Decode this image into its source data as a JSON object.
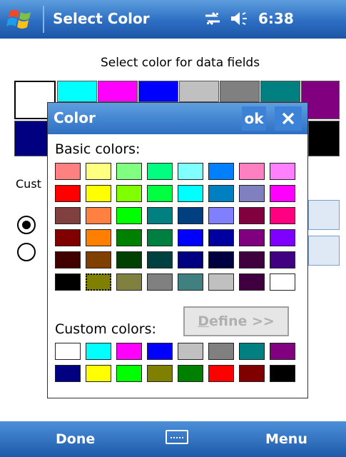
{
  "titlebar": {
    "title": "Select Color",
    "time": "6:38",
    "icons": [
      "windows-start-icon",
      "connectivity-icon",
      "volume-icon"
    ]
  },
  "page": {
    "prompt": "Select color for data fields",
    "background_swatches": [
      "#ffffff",
      "#00ffff",
      "#ff00ff",
      "#0000ff",
      "#c0c0c0",
      "#808080",
      "#008080",
      "#800080",
      "#000080",
      "#000000"
    ],
    "custom_label_partial": "Cust",
    "radio_checked": true
  },
  "dialog": {
    "title": "Color",
    "ok_label": "ok",
    "close_icon": "close-icon",
    "basic_colors_label": "Basic colors:",
    "custom_colors_label": "Custom colors:",
    "define_label": "Define >>",
    "basic_colors": [
      [
        "#ff8080",
        "#ffff80",
        "#80ff80",
        "#00ff80",
        "#80ffff",
        "#0080ff",
        "#ff80c0",
        "#ff80ff"
      ],
      [
        "#ff0000",
        "#ffff00",
        "#80ff00",
        "#00ff40",
        "#00ffff",
        "#0080c0",
        "#8080c0",
        "#ff00ff"
      ],
      [
        "#804040",
        "#ff8040",
        "#00ff00",
        "#008080",
        "#004080",
        "#8080ff",
        "#800040",
        "#ff0080"
      ],
      [
        "#800000",
        "#ff8000",
        "#008000",
        "#008040",
        "#0000ff",
        "#0000a0",
        "#800080",
        "#8000ff"
      ],
      [
        "#400000",
        "#804000",
        "#004000",
        "#004040",
        "#000080",
        "#000040",
        "#400040",
        "#400080"
      ],
      [
        "#000000",
        "#808000",
        "#808040",
        "#808080",
        "#408080",
        "#c0c0c0",
        "#400040",
        "#ffffff"
      ]
    ],
    "selected_basic": [
      5,
      1
    ],
    "custom_colors": [
      [
        "#ffffff",
        "#00ffff",
        "#ff00ff",
        "#0000ff",
        "#c0c0c0",
        "#808080",
        "#008080",
        "#800080"
      ],
      [
        "#000080",
        "#ffff00",
        "#00ff00",
        "#808000",
        "#008000",
        "#ff0000",
        "#800000",
        "#000000"
      ]
    ]
  },
  "bottombar": {
    "left_label": "Done",
    "right_label": "Menu",
    "keyboard_icon": "keyboard-icon"
  }
}
